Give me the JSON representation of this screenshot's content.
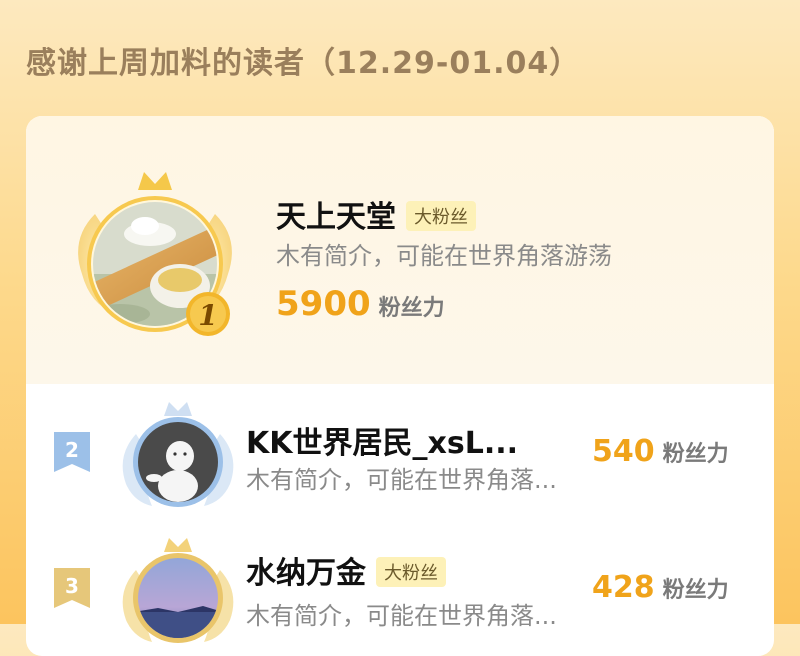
{
  "header": {
    "title": "感谢上周加料的读者（12.29-01.04）"
  },
  "colors": {
    "accent": "#f0a31a",
    "tag_bg": "#fdf1b8",
    "silver_flag": "#9cc0e8",
    "gold_flag": "#e6c77a"
  },
  "top_reader": {
    "rank": "1",
    "name": "天上天堂",
    "tag": "大粉丝",
    "bio": "木有简介，可能在世界角落游荡",
    "score": "5900",
    "score_unit": "粉丝力"
  },
  "readers": [
    {
      "rank": "2",
      "name": "KK世界居民_xsL...",
      "tag": "",
      "bio": "木有简介，可能在世界角落...",
      "score": "540",
      "score_unit": "粉丝力"
    },
    {
      "rank": "3",
      "name": "水纳万金",
      "tag": "大粉丝",
      "bio": "木有简介，可能在世界角落...",
      "score": "428",
      "score_unit": "粉丝力"
    }
  ]
}
